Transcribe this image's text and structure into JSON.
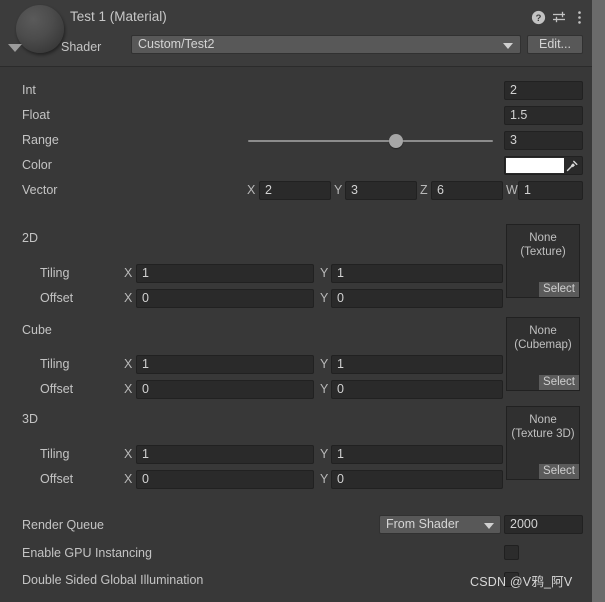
{
  "header": {
    "title": "Test 1 (Material)",
    "shader_label": "Shader",
    "shader_value": "Custom/Test2",
    "edit_label": "Edit...",
    "icons": {
      "help": "help-icon",
      "preset": "preset-icon",
      "menu": "more-menu-icon"
    },
    "preview": "material-sphere-preview",
    "foldout": "foldout-triangle"
  },
  "properties": {
    "int": {
      "label": "Int",
      "value": "2"
    },
    "float": {
      "label": "Float",
      "value": "1.5"
    },
    "range": {
      "label": "Range",
      "value": "3",
      "handle_percent": 58
    },
    "color": {
      "label": "Color",
      "swatch_hex": "#ffffff",
      "eyedropper": "eyedropper-icon"
    },
    "vector": {
      "label": "Vector",
      "components": [
        {
          "axis": "X",
          "value": "2"
        },
        {
          "axis": "Y",
          "value": "3"
        },
        {
          "axis": "Z",
          "value": "6"
        },
        {
          "axis": "W",
          "value": "1"
        }
      ]
    }
  },
  "textures": [
    {
      "name": "2D",
      "slot_text": "None\n(Texture)",
      "select_label": "Select",
      "tiling_label": "Tiling",
      "offset_label": "Offset",
      "tiling": {
        "x_axis": "X",
        "x": "1",
        "y_axis": "Y",
        "y": "1"
      },
      "offset": {
        "x_axis": "X",
        "x": "0",
        "y_axis": "Y",
        "y": "0"
      }
    },
    {
      "name": "Cube",
      "slot_text": "None\n(Cubemap)",
      "select_label": "Select",
      "tiling_label": "Tiling",
      "offset_label": "Offset",
      "tiling": {
        "x_axis": "X",
        "x": "1",
        "y_axis": "Y",
        "y": "1"
      },
      "offset": {
        "x_axis": "X",
        "x": "0",
        "y_axis": "Y",
        "y": "0"
      }
    },
    {
      "name": "3D",
      "slot_text": "None\n(Texture 3D)",
      "select_label": "Select",
      "tiling_label": "Tiling",
      "offset_label": "Offset",
      "tiling": {
        "x_axis": "X",
        "x": "1",
        "y_axis": "Y",
        "y": "1"
      },
      "offset": {
        "x_axis": "X",
        "x": "0",
        "y_axis": "Y",
        "y": "0"
      }
    }
  ],
  "footer": {
    "render_queue_label": "Render Queue",
    "render_queue_mode": "From Shader",
    "render_queue_value": "2000",
    "gpu_instancing_label": "Enable GPU Instancing",
    "gpu_instancing_checked": false,
    "double_sided_gi_label": "Double Sided Global Illumination",
    "double_sided_gi_checked": false
  },
  "watermark": "CSDN @V鸦_阿V",
  "colors": {
    "window_bg": "#383838",
    "header_bg": "#3c3c3c",
    "field_bg": "#2a2a2a",
    "button_bg": "#585858",
    "text": "#c4c4c4",
    "gutter": "#6b6b6b"
  }
}
